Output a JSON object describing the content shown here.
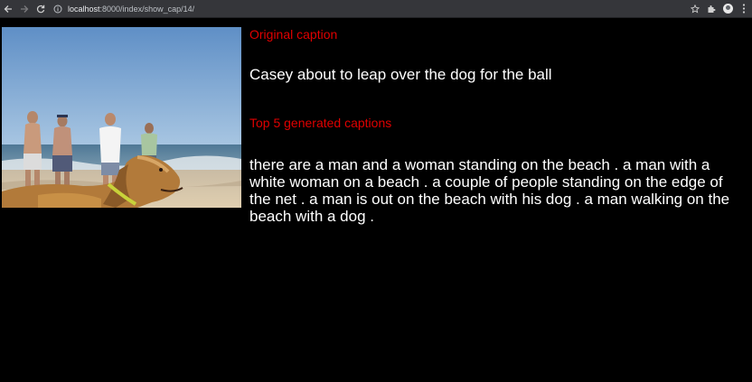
{
  "browser": {
    "url_host": "localhost",
    "url_rest": ":8000/index/show_cap/14/",
    "icons": [
      "back-arrow-icon",
      "forward-arrow-icon",
      "reload-icon",
      "info-icon",
      "star-icon",
      "extensions-puzzle-icon",
      "profile-avatar-icon",
      "kebab-menu-icon"
    ]
  },
  "page": {
    "original_heading": "Original caption",
    "original_caption": "Casey about to leap over the dog for the ball",
    "generated_heading": "Top 5 generated captions",
    "generated_captions": "there are a man and a woman standing on the beach . a man with a white woman on a beach . a couple of people standing on the edge of the net . a man is out on the beach with his dog . a man walking on the beach with a dog ."
  },
  "colors": {
    "background": "#000000",
    "heading": "#e00000",
    "text": "#ffffff",
    "chrome": "#35363a"
  }
}
